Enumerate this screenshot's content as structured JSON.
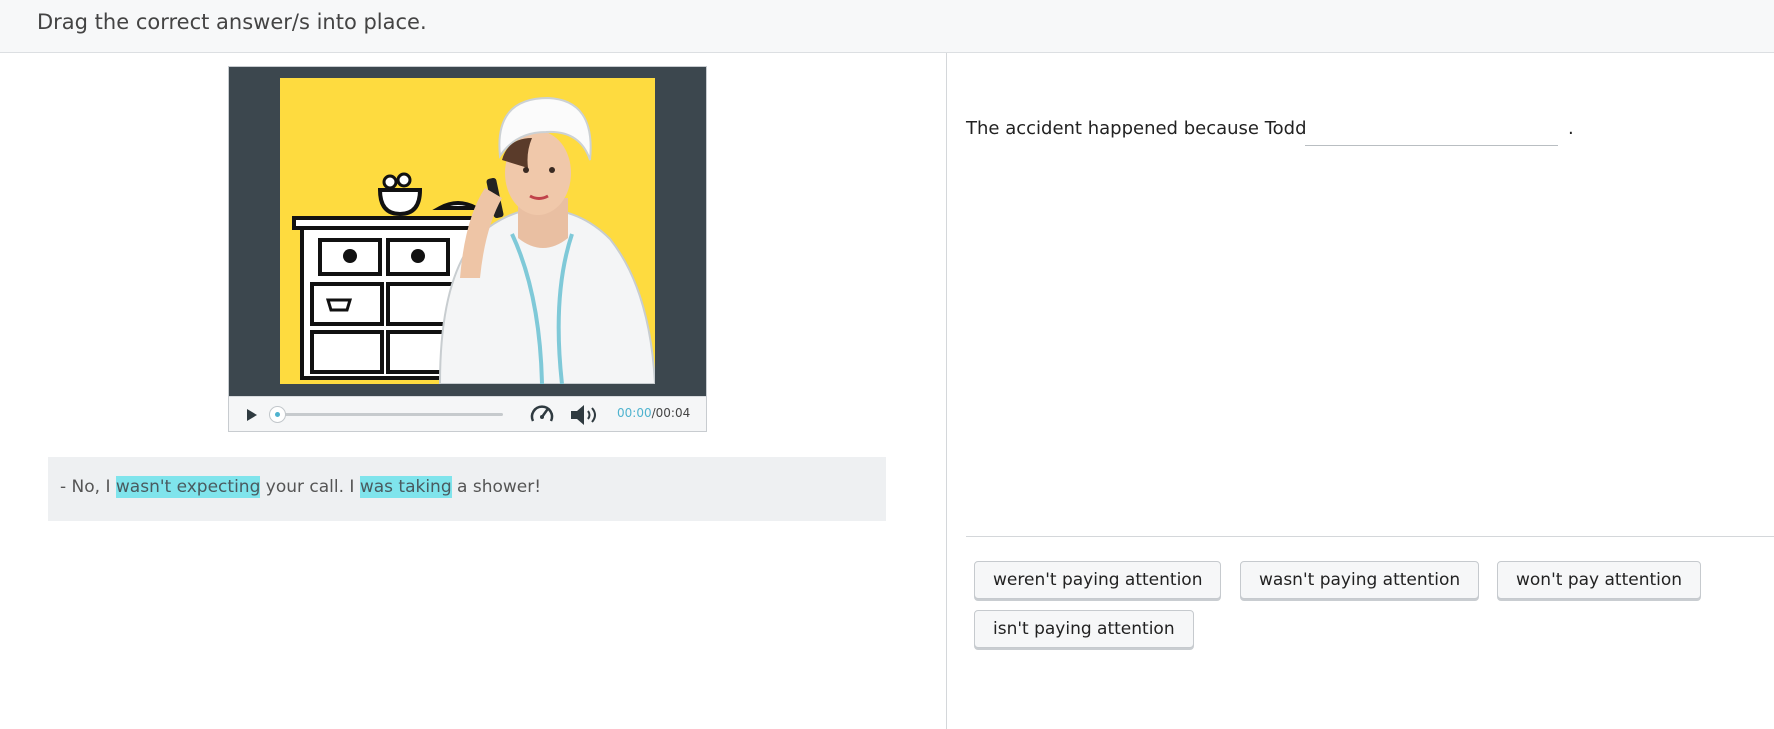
{
  "header": {
    "instruction": "Drag the correct answer/s into place."
  },
  "player": {
    "current_time": "00:00",
    "separator": "/",
    "duration": "00:04",
    "progress": 0,
    "accent_color": "#4fb3cf"
  },
  "transcript": {
    "prefix": "- No, I ",
    "highlight_1": "wasn't expecting",
    "middle": " your call. I ",
    "highlight_2": "was taking",
    "suffix": " a shower!",
    "highlight_color": "#7fe4ec"
  },
  "question": {
    "sentence_start": "The accident happened because Todd",
    "sentence_end": "."
  },
  "options": [
    "weren't paying attention",
    "wasn't paying attention",
    "won't pay attention",
    "isn't paying attention"
  ]
}
